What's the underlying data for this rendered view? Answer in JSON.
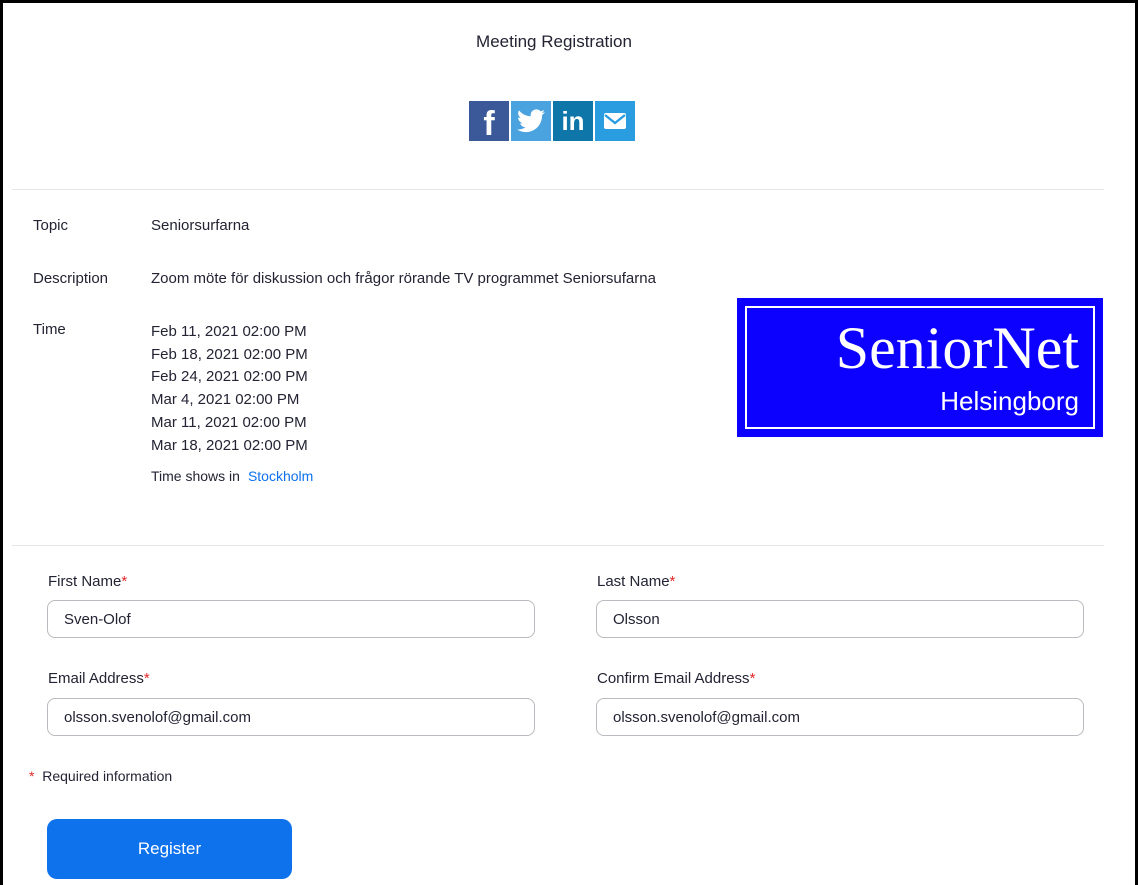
{
  "header": {
    "title": "Meeting Registration"
  },
  "share": {
    "facebook_glyph": "f",
    "linkedin_glyph": "in",
    "icons": [
      "facebook-icon",
      "twitter-icon",
      "linkedin-icon",
      "email-icon"
    ],
    "colors": {
      "facebook": "#3b5998",
      "twitter": "#4aa3df",
      "linkedin": "#0e76a8",
      "email": "#2a9de0"
    }
  },
  "meeting": {
    "topic_label": "Topic",
    "topic": "Seniorsurfarna",
    "description_label": "Description",
    "description": "Zoom möte för diskussion och frågor rörande TV programmet Seniorsufarna",
    "time_label": "Time",
    "times": [
      "Feb 11, 2021 02:00 PM",
      "Feb 18, 2021 02:00 PM",
      "Feb 24, 2021 02:00 PM",
      "Mar 4, 2021 02:00 PM",
      "Mar 11, 2021 02:00 PM",
      "Mar 18, 2021 02:00 PM"
    ],
    "timezone_prefix": "Time shows in",
    "timezone_link": "Stockholm"
  },
  "logo": {
    "main": "SeniorNet",
    "sub": "Helsingborg",
    "background": "#0c00ff"
  },
  "form": {
    "required_mark": "*",
    "first_name_label": "First Name",
    "first_name_value": "Sven-Olof",
    "last_name_label": "Last Name",
    "last_name_value": "Olsson",
    "email_label": "Email Address",
    "email_value": "olsson.svenolof@gmail.com",
    "confirm_email_label": "Confirm Email Address",
    "confirm_email_value": "olsson.svenolof@gmail.com",
    "required_note": "Required information",
    "register_label": "Register",
    "accent": "#0e72ed"
  }
}
